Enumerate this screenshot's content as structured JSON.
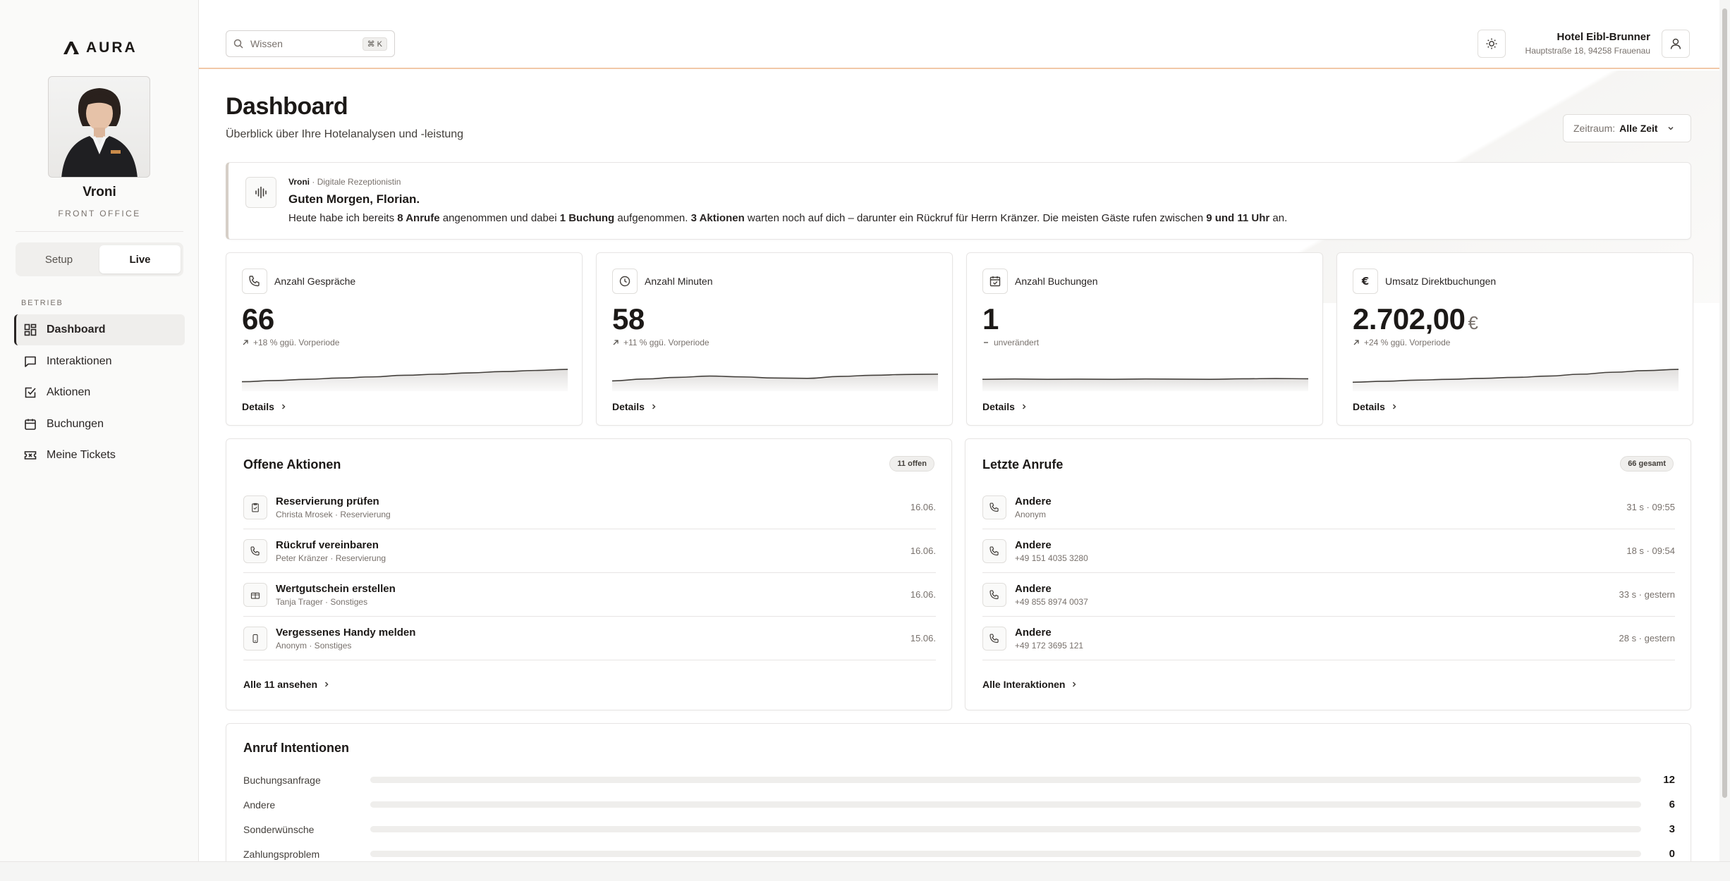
{
  "app": {
    "logo_text": "AURA"
  },
  "agent": {
    "name": "Vroni",
    "role": "FRONT OFFICE"
  },
  "mode": {
    "setup_label": "Setup",
    "live_label": "Live",
    "active": "Live"
  },
  "sidebar": {
    "section_label": "BETRIEB",
    "items": [
      {
        "label": "Dashboard",
        "icon": "dashboard-icon",
        "active": true
      },
      {
        "label": "Interaktionen",
        "icon": "chat-icon",
        "active": false
      },
      {
        "label": "Aktionen",
        "icon": "checkbox-icon",
        "active": false
      },
      {
        "label": "Buchungen",
        "icon": "calendar-icon",
        "active": false
      },
      {
        "label": "Meine Tickets",
        "icon": "ticket-icon",
        "active": false
      }
    ]
  },
  "header": {
    "search_placeholder": "Wissen",
    "search_shortcut": "⌘ K",
    "hotel_name": "Hotel Eibl-Brunner",
    "hotel_address": "Hauptstraße 18, 94258 Frauenau"
  },
  "page": {
    "title": "Dashboard",
    "subtitle": "Überblick über Ihre Hotelanalysen und -leistung",
    "range_label": "Zeitraum:",
    "range_value": "Alle Zeit"
  },
  "welcome": {
    "name": "Vroni",
    "separator": " · ",
    "role": "Digitale Rezeptionistin",
    "greeting": "Guten Morgen, Florian.",
    "message_parts": [
      {
        "text": "Heute habe ich bereits ",
        "bold": false
      },
      {
        "text": "8 Anrufe",
        "bold": true
      },
      {
        "text": " angenommen und dabei ",
        "bold": false
      },
      {
        "text": "1 Buchung",
        "bold": true
      },
      {
        "text": " aufgenommen. ",
        "bold": false
      },
      {
        "text": "3 Aktionen",
        "bold": true
      },
      {
        "text": " warten noch auf dich – darunter ein Rückruf für Herrn Kränzer. Die meisten Gäste rufen zwischen ",
        "bold": false
      },
      {
        "text": "9 und 11 Uhr",
        "bold": true
      },
      {
        "text": " an.",
        "bold": false
      }
    ]
  },
  "kpis": [
    {
      "label": "Anzahl Gespräche",
      "icon": "phone-icon",
      "value": "66",
      "currency": "",
      "trend": "up",
      "change": "+18 % ggü. Vorperiode",
      "details": "Details",
      "spark": [
        0.15,
        0.22,
        0.3,
        0.38,
        0.45,
        0.55,
        0.62,
        0.7,
        0.78,
        0.85,
        0.92
      ]
    },
    {
      "label": "Anzahl Minuten",
      "icon": "clock-icon",
      "value": "58",
      "currency": "",
      "trend": "up",
      "change": "+11 % ggü. Vorperiode",
      "details": "Details",
      "spark": [
        0.2,
        0.32,
        0.42,
        0.5,
        0.45,
        0.38,
        0.36,
        0.48,
        0.55,
        0.6,
        0.62
      ]
    },
    {
      "label": "Anzahl Buchungen",
      "icon": "calendar-check-icon",
      "value": "1",
      "currency": "",
      "trend": "flat",
      "change": "unverändert",
      "details": "Details",
      "spark": [
        0.3,
        0.32,
        0.3,
        0.31,
        0.3,
        0.32,
        0.31,
        0.3,
        0.33,
        0.35,
        0.33
      ]
    },
    {
      "label": "Umsatz Direktbuchungen",
      "icon": "euro-icon",
      "value": "2.702,00",
      "currency": "€",
      "trend": "up",
      "change": "+24 % ggü. Vorperiode",
      "details": "Details",
      "spark": [
        0.12,
        0.18,
        0.25,
        0.3,
        0.36,
        0.42,
        0.5,
        0.62,
        0.74,
        0.84,
        0.92
      ]
    }
  ],
  "actions": {
    "title": "Offene Aktionen",
    "badge": "11 offen",
    "items": [
      {
        "title": "Reservierung prüfen",
        "subtitle": "Christa Mrosek · Reservierung",
        "date": "16.06.",
        "icon": "clipboard-check-icon"
      },
      {
        "title": "Rückruf vereinbaren",
        "subtitle": "Peter Kränzer · Reservierung",
        "date": "16.06.",
        "icon": "phone-icon"
      },
      {
        "title": "Wertgutschein erstellen",
        "subtitle": "Tanja Trager · Sonstiges",
        "date": "16.06.",
        "icon": "gift-icon"
      },
      {
        "title": "Vergessenes Handy melden",
        "subtitle": "Anonym · Sonstiges",
        "date": "15.06.",
        "icon": "smartphone-icon"
      }
    ],
    "footer": "Alle 11 ansehen"
  },
  "calls": {
    "title": "Letzte Anrufe",
    "badge": "66 gesamt",
    "items": [
      {
        "title": "Andere",
        "subtitle": "Anonym",
        "meta": "31 s · 09:55",
        "icon": "phone-icon"
      },
      {
        "title": "Andere",
        "subtitle": "+49 151 4035 3280",
        "meta": "18 s · 09:54",
        "icon": "phone-icon"
      },
      {
        "title": "Andere",
        "subtitle": "+49 855 8974 0037",
        "meta": "33 s · gestern",
        "icon": "phone-icon"
      },
      {
        "title": "Andere",
        "subtitle": "+49 172 3695 121",
        "meta": "28 s · gestern",
        "icon": "phone-icon"
      }
    ],
    "footer": "Alle Interaktionen"
  },
  "intents": {
    "title": "Anruf Intentionen",
    "items": [
      {
        "label": "Buchungsanfrage",
        "value": "12",
        "fraction": 0
      },
      {
        "label": "Andere",
        "value": "6",
        "fraction": 0
      },
      {
        "label": "Sonderwünsche",
        "value": "3",
        "fraction": 0
      },
      {
        "label": "Zahlungsproblem",
        "value": "0",
        "fraction": 0
      }
    ]
  },
  "colors": {
    "accent_line": "#f1c8a8",
    "text": "#1c1917",
    "muted": "#78716c"
  }
}
